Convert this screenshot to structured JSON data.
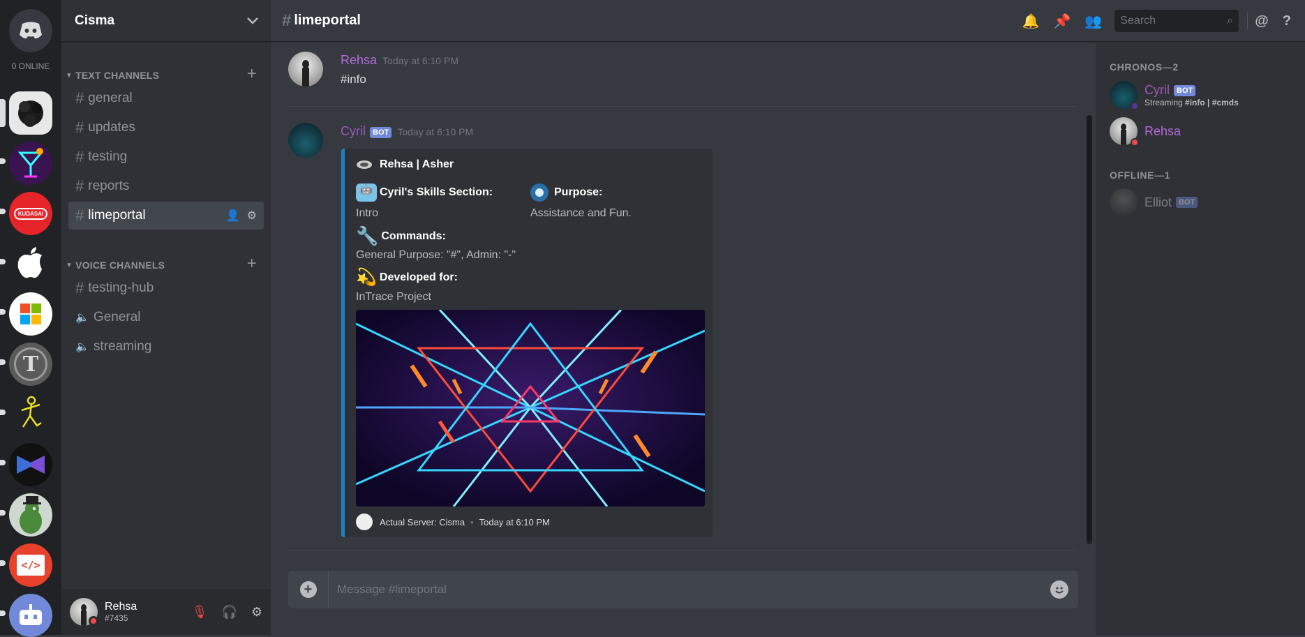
{
  "colors": {
    "bg": "#36393f",
    "sidebar": "#2f3136",
    "rail": "#202225",
    "blurple": "#7289da",
    "rehsa": "#b36bd6",
    "cyril": "#9b59b6",
    "embed_border": "#1e7fbd",
    "dnd": "#f04747",
    "streaming": "#593695"
  },
  "rail": {
    "online_label": "0 ONLINE"
  },
  "guild": {
    "name": "Cisma"
  },
  "categories": {
    "text": "TEXT CHANNELS",
    "voice": "VOICE CHANNELS"
  },
  "text_channels": [
    {
      "name": "general",
      "icon": "hash-icon"
    },
    {
      "name": "updates",
      "icon": "hash-icon"
    },
    {
      "name": "testing",
      "icon": "hash-icon"
    },
    {
      "name": "reports",
      "icon": "hash-icon"
    },
    {
      "name": "limeportal",
      "icon": "locked-hash-icon",
      "selected": true
    }
  ],
  "voice_channels": [
    {
      "name": "testing-hub",
      "icon": "locked-hash-icon"
    },
    {
      "name": "General",
      "icon": "speaker-icon"
    },
    {
      "name": "streaming",
      "icon": "speaker-icon"
    }
  ],
  "user": {
    "name": "Rehsa",
    "tag": "#7435"
  },
  "header": {
    "channel": "limeportal",
    "search_placeholder": "Search"
  },
  "messages": [
    {
      "author": "Rehsa",
      "time": "Today at 6:10 PM",
      "text": "#info"
    },
    {
      "author": "Cyril",
      "bot": "BOT",
      "time": "Today at 6:10 PM"
    }
  ],
  "embed": {
    "author": "Rehsa | Asher",
    "fields": [
      {
        "name": "Cyril's Skills Section:",
        "value": "Intro",
        "icon": "robot-icon"
      },
      {
        "name": "Purpose:",
        "value": "Assistance and Fun.",
        "icon": "radio-button-icon"
      },
      {
        "name": "Commands:",
        "value": "General Purpose: \"#\", Admin: \"-\"",
        "icon": "wrench-icon"
      },
      {
        "name": "Developed for:",
        "value": "InTrace Project",
        "icon": "dizzy-star-icon"
      }
    ],
    "footer": "Actual Server: Cisma",
    "footer_time": "Today at 6:10 PM"
  },
  "composer": {
    "placeholder": "Message #limeportal"
  },
  "members": {
    "online_header": "CHRONOS—2",
    "offline_header": "OFFLINE—1",
    "list": [
      {
        "name": "Cyril",
        "bot": "BOT",
        "activity_prefix": "Streaming ",
        "activity": "#info | #cmds"
      },
      {
        "name": "Rehsa"
      },
      {
        "name": "Elliot",
        "bot": "BOT"
      }
    ]
  }
}
